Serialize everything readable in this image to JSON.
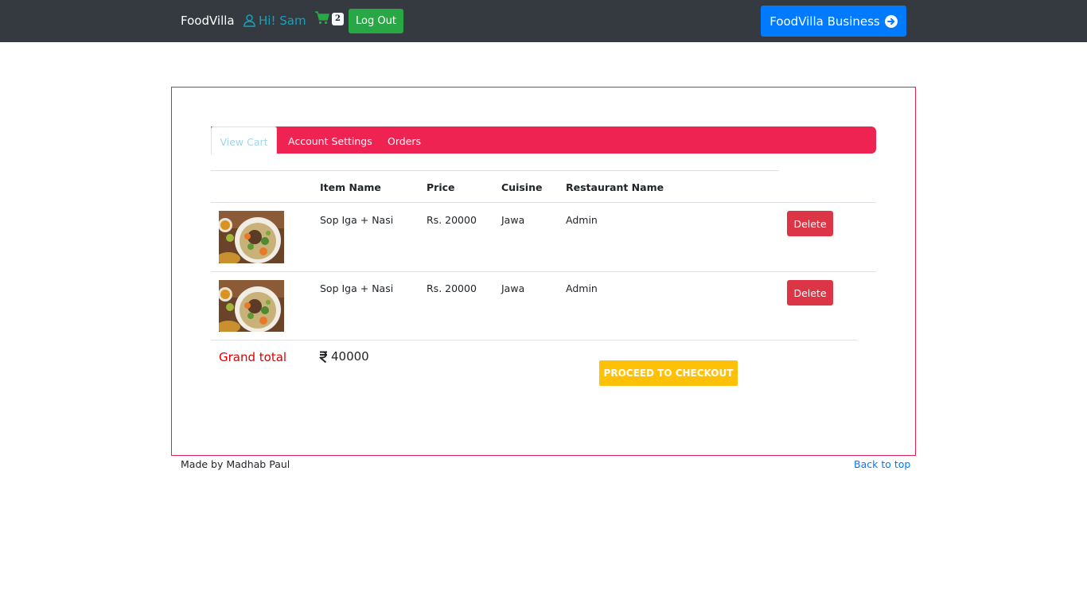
{
  "navbar": {
    "brand": "FoodVilla",
    "user_greeting": "Hi! Sam",
    "cart_count": "2",
    "logout_label": "Log Out",
    "business_label": "FoodVilla Business"
  },
  "tabs": [
    {
      "label": "View Cart",
      "active": true
    },
    {
      "label": "Account Settings",
      "active": false
    },
    {
      "label": "Orders",
      "active": false
    }
  ],
  "table": {
    "headers": [
      "",
      "Item Name",
      "Price",
      "Cuisine",
      "Restaurant Name"
    ],
    "rows": [
      {
        "image": "food-photo",
        "item": "Sop Iga + Nasi",
        "price": "Rs. 20000",
        "cuisine": "Jawa",
        "restaurant": "Admin",
        "action": "Delete"
      },
      {
        "image": "food-photo",
        "item": "Sop Iga + Nasi",
        "price": "Rs. 20000",
        "cuisine": "Jawa",
        "restaurant": "Admin",
        "action": "Delete"
      }
    ]
  },
  "summary": {
    "grand_total_label": "Grand total",
    "grand_total_value": "40000",
    "checkout_label": "PROCEED TO CHECKOUT"
  },
  "footer": {
    "credit": "Made by Madhab Paul",
    "back_to_top": "Back to top"
  },
  "colors": {
    "navbar": "#343a40",
    "tabs": "#ef2351",
    "accent_border": "#e0234e",
    "logout": "#28a745",
    "business": "#007bff",
    "delete": "#dc3545",
    "checkout": "#ffc107"
  }
}
